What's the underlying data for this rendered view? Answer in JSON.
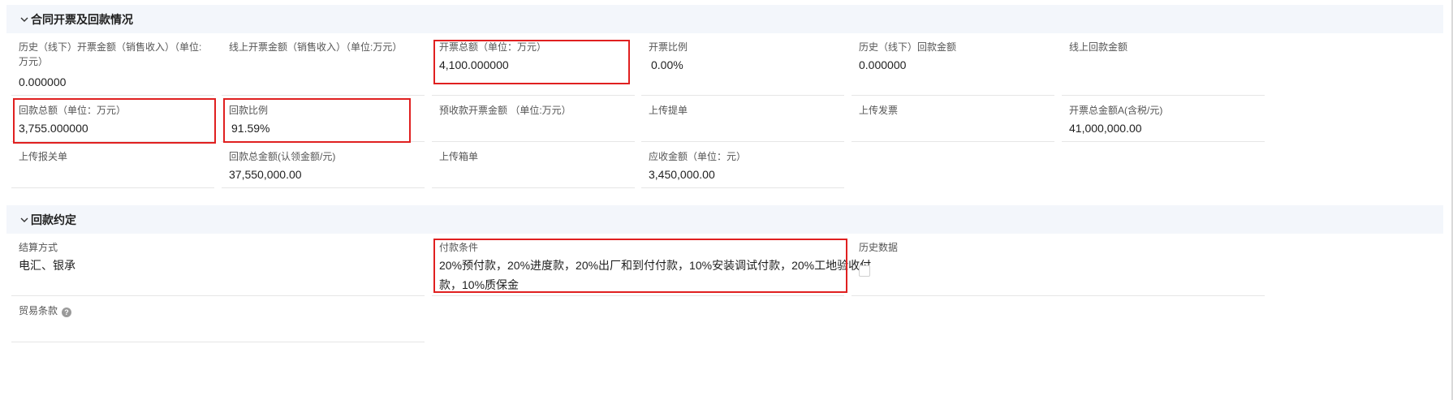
{
  "sections": {
    "invoice": {
      "title": "合同开票及回款情况"
    },
    "payment": {
      "title": "回款约定"
    }
  },
  "fields": {
    "hist_offline_invoice": {
      "label": "历史（线下）开票金额（销售收入）（单位:万元）",
      "value": "0.000000"
    },
    "online_invoice": {
      "label": "线上开票金额（销售收入）（单位:万元）",
      "value": ""
    },
    "invoice_total": {
      "label": "开票总额（单位：万元）",
      "value": "4,100.000000"
    },
    "invoice_ratio": {
      "label": "开票比例",
      "value": "0.00%"
    },
    "hist_offline_payment": {
      "label": "历史（线下）回款金额",
      "value": "0.000000"
    },
    "online_payment": {
      "label": "线上回款金额",
      "value": ""
    },
    "payment_total": {
      "label": "回款总额（单位：万元）",
      "value": "3,755.000000"
    },
    "payment_ratio": {
      "label": "回款比例",
      "value": "91.59%"
    },
    "prepay_invoice": {
      "label": "预收款开票金额 （单位:万元）",
      "value": ""
    },
    "upload_bill_lading": {
      "label": "上传提单",
      "value": ""
    },
    "upload_invoice": {
      "label": "上传发票",
      "value": ""
    },
    "invoice_total_a": {
      "label": "开票总金额A(含税/元)",
      "value": "41,000,000.00"
    },
    "upload_customs": {
      "label": "上传报关单",
      "value": ""
    },
    "payment_total_yuan": {
      "label": "回款总金额(认领金额/元)",
      "value": "37,550,000.00"
    },
    "upload_packing": {
      "label": "上传箱单",
      "value": ""
    },
    "receivable": {
      "label": "应收金额（单位：元）",
      "value": "3,450,000.00"
    },
    "settlement": {
      "label": "结算方式",
      "value": "电汇、银承"
    },
    "payment_terms": {
      "label": "付款条件",
      "value_line1": "20%预付款，20%进度款，20%出厂和到付付款，10%安装调试付款，20%工地验收付",
      "value_line2": "款，10%质保金"
    },
    "history_data": {
      "label": "历史数据",
      "checked": false
    },
    "trade_terms": {
      "label": "贸易条款",
      "help_icon": "?"
    }
  },
  "highlight_color": "#e02020"
}
